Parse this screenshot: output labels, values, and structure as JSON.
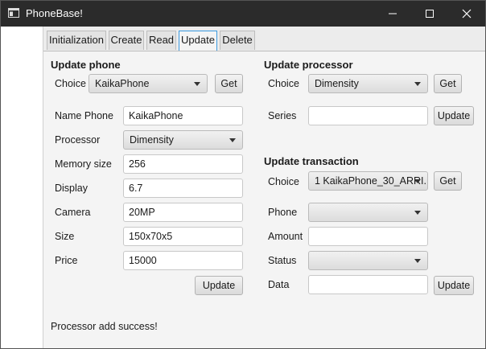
{
  "window": {
    "title": "PhoneBase!"
  },
  "tabs": [
    "Initialization",
    "Create",
    "Read",
    "Update",
    "Delete"
  ],
  "active_tab": "Update",
  "update_phone": {
    "heading": "Update phone",
    "choice_label": "Choice",
    "choice_value": "KaikaPhone",
    "get_label": "Get",
    "fields": {
      "name": {
        "label": "Name Phone",
        "value": "KaikaPhone"
      },
      "processor": {
        "label": "Processor",
        "value": "Dimensity"
      },
      "memory": {
        "label": "Memory size",
        "value": "256"
      },
      "display": {
        "label": "Display",
        "value": "6.7"
      },
      "camera": {
        "label": "Camera",
        "value": "20MP"
      },
      "size": {
        "label": "Size",
        "value": "150x70x5"
      },
      "price": {
        "label": "Price",
        "value": "15000"
      }
    },
    "update_label": "Update"
  },
  "update_processor": {
    "heading": "Update processor",
    "choice_label": "Choice",
    "choice_value": "Dimensity",
    "get_label": "Get",
    "series_label": "Series",
    "series_value": "",
    "update_label": "Update"
  },
  "update_transaction": {
    "heading": "Update transaction",
    "choice_label": "Choice",
    "choice_value": "1 KaikaPhone_30_ARRI...",
    "get_label": "Get",
    "phone_label": "Phone",
    "phone_value": "",
    "amount_label": "Amount",
    "amount_value": "",
    "status_label": "Status",
    "status_value": "",
    "data_label": "Data",
    "data_value": "",
    "update_label": "Update"
  },
  "status_message": "Processor add success!",
  "colors": {
    "titlebar": "#2b2b2b",
    "tab_focus": "#3b9ae0",
    "background": "#f4f4f4"
  },
  "icons": {
    "app": "app-window-icon",
    "minimize": "minimize-icon",
    "maximize": "maximize-icon",
    "close": "close-icon"
  }
}
